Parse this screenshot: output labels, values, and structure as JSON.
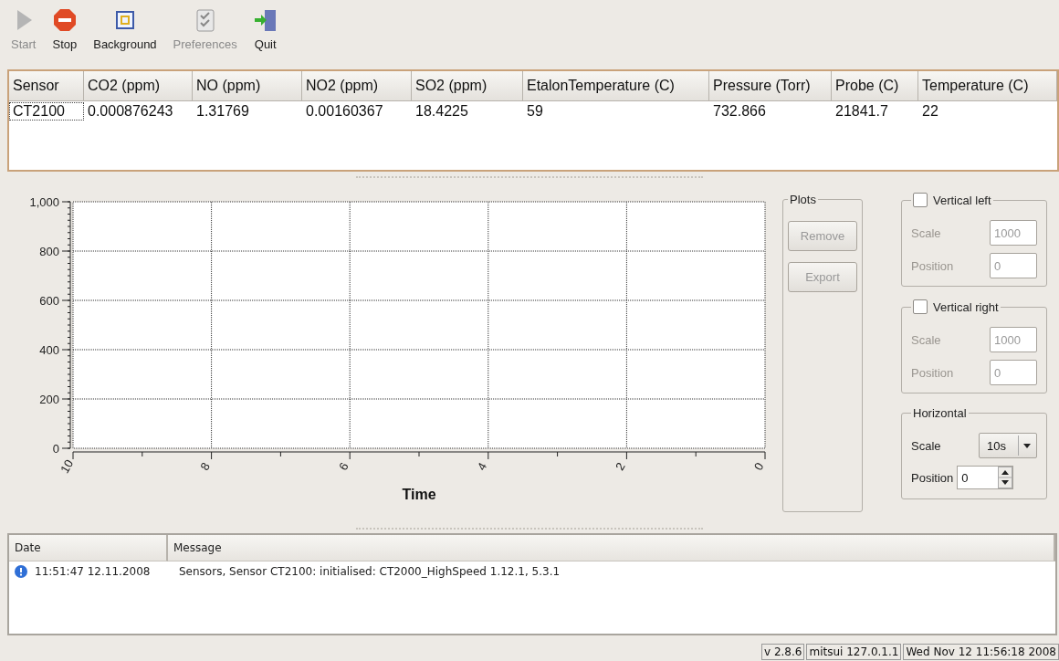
{
  "toolbar": [
    {
      "kind": "start",
      "label": "Start",
      "disabled": true
    },
    {
      "kind": "stop",
      "label": "Stop",
      "disabled": false
    },
    {
      "kind": "background",
      "label": "Background",
      "disabled": false
    },
    {
      "kind": "preferences",
      "label": "Preferences",
      "disabled": true
    },
    {
      "kind": "quit",
      "label": "Quit",
      "disabled": false
    }
  ],
  "sensor_table": {
    "columns": [
      "Sensor",
      "CO2 (ppm)",
      "NO (ppm)",
      "NO2 (ppm)",
      "SO2 (ppm)",
      "EtalonTemperature (C)",
      "Pressure (Torr)",
      "Probe (C)",
      "Temperature (C)"
    ],
    "rows": [
      {
        "cells": [
          {
            "text": "CT2100",
            "focused": true
          },
          {
            "text": "0.000876243",
            "focused": false
          },
          {
            "text": "1.31769",
            "focused": false
          },
          {
            "text": "0.00160367",
            "focused": false
          },
          {
            "text": "18.4225",
            "focused": false
          },
          {
            "text": "59",
            "focused": false
          },
          {
            "text": "732.866",
            "focused": false
          },
          {
            "text": "21841.7",
            "focused": false
          },
          {
            "text": "22",
            "focused": false
          }
        ]
      }
    ]
  },
  "chart": {
    "chart_data": {
      "type": "line",
      "grid": true,
      "xlabel": "Time",
      "xlim": [
        10,
        0
      ],
      "ylim": [
        0,
        1000
      ],
      "xticks": [
        10,
        8,
        6,
        4,
        2,
        0
      ],
      "yticks": [
        0,
        200,
        400,
        600,
        800,
        {
          "value": 1000,
          "label": "1,000"
        }
      ]
    }
  },
  "plots": {
    "title": "Plots",
    "buttons": [
      {
        "label": "Remove",
        "disabled": true
      },
      {
        "label": "Export",
        "disabled": true
      }
    ]
  },
  "axes": [
    {
      "title": "Vertical left",
      "checked": false,
      "fields": [
        {
          "label": "Scale",
          "value": "1000"
        },
        {
          "label": "Position",
          "value": "0"
        }
      ]
    },
    {
      "title": "Vertical right",
      "checked": false,
      "fields": [
        {
          "label": "Scale",
          "value": "1000"
        },
        {
          "label": "Position",
          "value": "0"
        }
      ]
    }
  ],
  "horizontal": {
    "title": "Horizontal",
    "scale": {
      "label": "Scale",
      "value": "10s"
    },
    "position": {
      "label": "Position",
      "value": "0"
    }
  },
  "log": {
    "columns": [
      "Date",
      "Message"
    ],
    "rows": [
      {
        "kind": "info",
        "date": "11:51:47 12.11.2008",
        "message": "Sensors, Sensor CT2100: initialised: CT2000_HighSpeed 1.12.1, 5.3.1"
      }
    ]
  },
  "status_bar": [
    "v 2.8.6",
    "mitsui 127.0.1.1",
    "Wed Nov 12 11:56:18 2008"
  ]
}
